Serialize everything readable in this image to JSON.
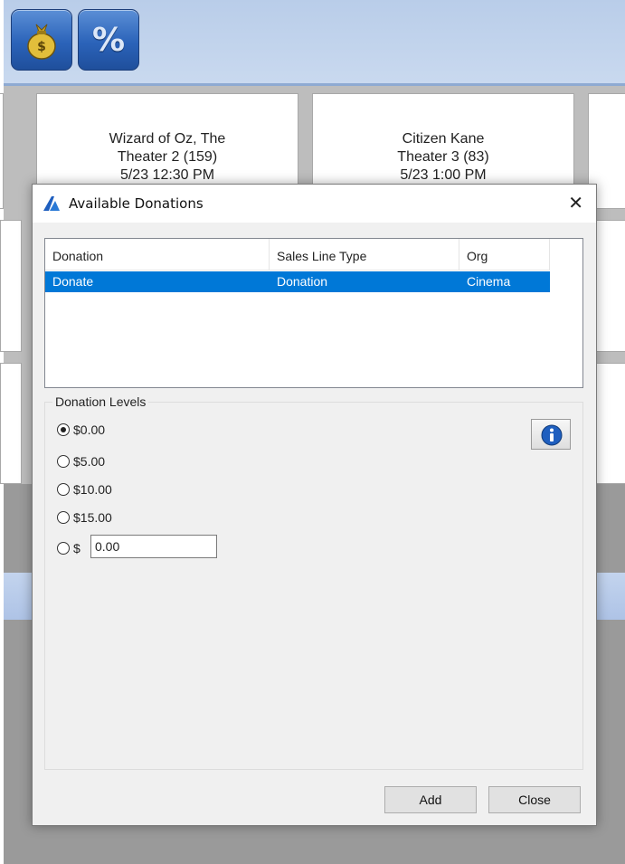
{
  "toolbar": {
    "buttons": [
      {
        "icon": "money-bag-icon"
      },
      {
        "icon": "percent-icon",
        "glyph": "%"
      }
    ]
  },
  "showings": [
    {
      "title": "Wizard of Oz, The",
      "theater": "Theater 2 (159)",
      "time": "5/23 12:30 PM"
    },
    {
      "title": "Citizen Kane",
      "theater": "Theater 3 (83)",
      "time": "5/23 1:00 PM"
    }
  ],
  "dialog": {
    "title": "Available Donations",
    "close_glyph": "✕",
    "list": {
      "columns": [
        "Donation",
        "Sales Line Type",
        "Org"
      ],
      "rows": [
        {
          "donation": "Donate",
          "sales_line_type": "Donation",
          "org": "Cinema",
          "selected": true
        }
      ]
    },
    "levels": {
      "label": "Donation Levels",
      "options": [
        "$0.00",
        "$5.00",
        "$10.00",
        "$15.00"
      ],
      "selected": "$0.00",
      "custom_prefix": "$",
      "custom_value": "0.00"
    },
    "buttons": {
      "add": "Add",
      "close": "Close"
    }
  },
  "colors": {
    "selection": "#0078d7",
    "toolbar_button": "#2b63b9"
  }
}
